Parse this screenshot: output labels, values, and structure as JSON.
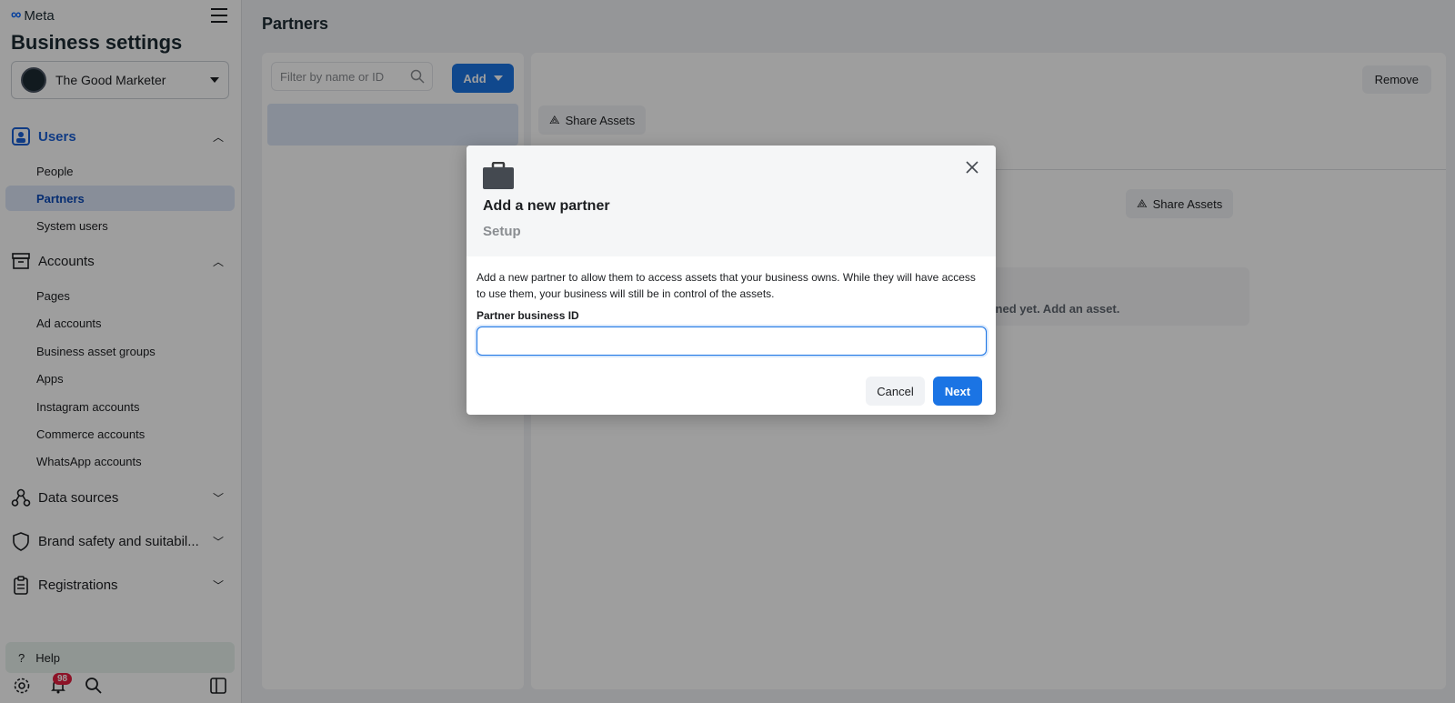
{
  "sidebar": {
    "brand": "Meta",
    "title": "Business settings",
    "business_name": "The Good Marketer",
    "sections": {
      "users": "Users",
      "accounts": "Accounts",
      "data_sources": "Data sources",
      "brand_safety": "Brand safety and suitabil...",
      "registrations": "Registrations"
    },
    "users_items": [
      "People",
      "Partners",
      "System users"
    ],
    "accounts_items": [
      "Pages",
      "Ad accounts",
      "Business asset groups",
      "Apps",
      "Instagram accounts",
      "Commerce accounts",
      "WhatsApp accounts"
    ],
    "help": "Help",
    "notification_count": "98"
  },
  "main": {
    "title": "Partners",
    "filter_placeholder": "Filter by name or ID",
    "add_label": "Add",
    "remove_label": "Remove",
    "share_assets_label": "Share Assets",
    "empty_text": "igned yet. Add an asset."
  },
  "modal": {
    "title": "Add a new partner",
    "subtitle": "Setup",
    "description": "Add a new partner to allow them to access assets that your business owns. While they will have access to use them, your business will still be in control of the assets.",
    "field_label": "Partner business ID",
    "field_value": "",
    "cancel_label": "Cancel",
    "next_label": "Next"
  },
  "colors": {
    "primary": "#1b74e4",
    "active_nav_bg": "#dbe5f7",
    "badge": "#e41e3f"
  }
}
